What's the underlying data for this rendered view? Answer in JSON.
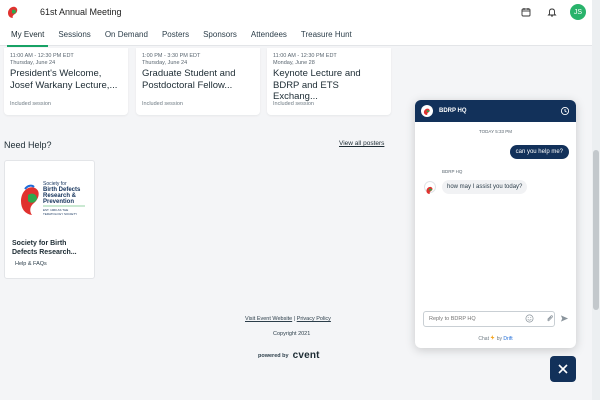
{
  "header": {
    "event_title": "61st Annual Meeting",
    "avatar_initials": "JS"
  },
  "tabs": [
    {
      "label": "My Event"
    },
    {
      "label": "Sessions"
    },
    {
      "label": "On Demand"
    },
    {
      "label": "Posters"
    },
    {
      "label": "Sponsors"
    },
    {
      "label": "Attendees"
    },
    {
      "label": "Treasure Hunt"
    }
  ],
  "sessions": [
    {
      "time": "11:00 AM - 12:30 PM EDT",
      "date": "Thursday, June 24",
      "title_line1": "President's Welcome,",
      "title_line2": "Josef Warkany Lecture,...",
      "tag": "Included session"
    },
    {
      "time": "1:00 PM - 3:30 PM EDT",
      "date": "Thursday, June 24",
      "title_line1": "Graduate Student and",
      "title_line2": "Postdoctoral Fellow...",
      "tag": "Included session"
    },
    {
      "time": "11:00 AM - 12:30 PM EDT",
      "date": "Monday, June 28",
      "title_line1": "Keynote Lecture and",
      "title_line2": "BDRP and ETS Exchang...",
      "tag": "Included session"
    }
  ],
  "help": {
    "heading": "Need Help?",
    "view_all": "View all posters",
    "sponsor_name": "Society for Birth Defects Research...",
    "sponsor_link": "Help & FAQs",
    "logo_lines": [
      "Society for",
      "Birth Defects",
      "Research &",
      "Prevention",
      "EST. 1960 AS THE",
      "TERATOLOGY SOCIETY"
    ]
  },
  "footer": {
    "visit_site": "Visit Event Website",
    "separator": "|",
    "privacy": "Privacy Policy",
    "copyright": "Copyright 2021",
    "powered_by": "powered by",
    "brand": "cvent"
  },
  "chat": {
    "name": "BDRP HQ",
    "timestamp": "TODAY 5:33 PM",
    "user_message": "can you help me?",
    "bot_label": "BDRP HQ",
    "bot_message": "how may I assist you today?",
    "input_placeholder": "Reply to BDRP HQ",
    "footer_prefix": "Chat",
    "footer_by": "by",
    "footer_brand": "Drift"
  },
  "colors": {
    "accent": "#17a265",
    "chat_navy": "#12315a",
    "avatar_green": "#29b36b"
  }
}
